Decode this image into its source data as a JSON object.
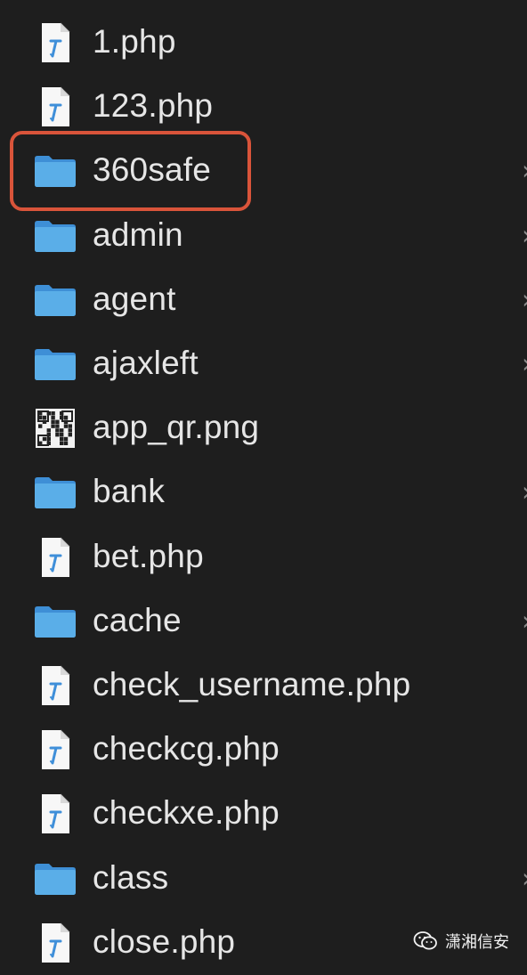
{
  "files": [
    {
      "name": "1.php",
      "type": "php",
      "icon": "php-file-icon",
      "has_children": false
    },
    {
      "name": "123.php",
      "type": "php",
      "icon": "php-file-icon",
      "has_children": false
    },
    {
      "name": "360safe",
      "type": "folder",
      "icon": "folder-icon",
      "has_children": true,
      "highlighted": true
    },
    {
      "name": "admin",
      "type": "folder",
      "icon": "folder-icon",
      "has_children": true
    },
    {
      "name": "agent",
      "type": "folder",
      "icon": "folder-icon",
      "has_children": true
    },
    {
      "name": "ajaxleft",
      "type": "folder",
      "icon": "folder-icon",
      "has_children": true
    },
    {
      "name": "app_qr.png",
      "type": "image",
      "icon": "qr-image-icon",
      "has_children": false
    },
    {
      "name": "bank",
      "type": "folder",
      "icon": "folder-icon",
      "has_children": true
    },
    {
      "name": "bet.php",
      "type": "php",
      "icon": "php-file-icon",
      "has_children": false
    },
    {
      "name": "cache",
      "type": "folder",
      "icon": "folder-icon",
      "has_children": true
    },
    {
      "name": "check_username.php",
      "type": "php",
      "icon": "php-file-icon",
      "has_children": false
    },
    {
      "name": "checkcg.php",
      "type": "php",
      "icon": "php-file-icon",
      "has_children": false
    },
    {
      "name": "checkxe.php",
      "type": "php",
      "icon": "php-file-icon",
      "has_children": false
    },
    {
      "name": "class",
      "type": "folder",
      "icon": "folder-icon",
      "has_children": true
    },
    {
      "name": "close.php",
      "type": "php",
      "icon": "php-file-icon",
      "has_children": false
    }
  ],
  "chevron_glyph": "›",
  "watermark": {
    "text": "潇湘信安",
    "icon": "wechat-icon"
  },
  "colors": {
    "background": "#1e1e1e",
    "text": "#e6e6e6",
    "folder": "#5aaee8",
    "highlight_border": "#d9543a",
    "chevron": "#8a8a8a"
  }
}
